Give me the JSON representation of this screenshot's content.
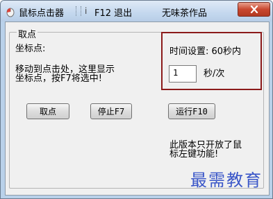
{
  "titlebar": {
    "title": "鼠标点击器",
    "sep": "i",
    "menu_f12": "F12 退出",
    "menu_author": "无味茶作品",
    "close_label": "x"
  },
  "group": {
    "label": "取点",
    "coord_label": "坐标点:",
    "hint_line1": "移动到点击处，这里显示",
    "hint_line2": "坐标点，按F7将选中!"
  },
  "buttons": {
    "pick": "取点",
    "stop": "停止F7",
    "run": "运行F10"
  },
  "time": {
    "label": "时间设置: 60秒内",
    "value": "1",
    "unit": "秒/次"
  },
  "info": {
    "line1": "此版本只开放了鼠",
    "line2": "标左键功能!"
  },
  "watermark": "最需教育",
  "colors": {
    "highlight_border": "#8b1a1a",
    "watermark": "#3a56c8",
    "close_button": "#c9472f"
  }
}
